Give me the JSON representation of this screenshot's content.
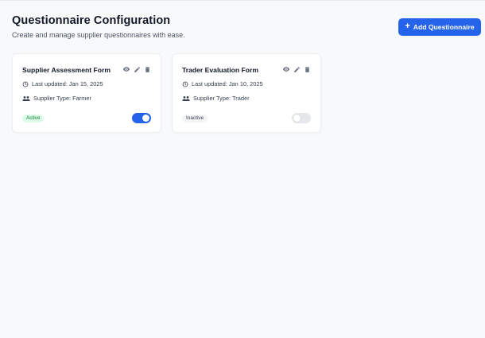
{
  "header": {
    "title": "Questionnaire Configuration",
    "subtitle": "Create and manage supplier questionnaires with ease.",
    "add_button_label": "Add Questionnaire",
    "add_button_icon": "plus-icon"
  },
  "colors": {
    "accent": "#2563eb",
    "active_badge_bg": "#dcfce7",
    "active_badge_text": "#15803d",
    "inactive_badge_bg": "#f3f4f6"
  },
  "cards": [
    {
      "title": "Supplier Assessment Form",
      "last_updated": "Last updated: Jan 15, 2025",
      "supplier_type": "Supplier Type: Farmer",
      "status": "Active",
      "enabled": true,
      "icons": [
        "eye-icon",
        "pencil-icon",
        "trash-icon",
        "clock-icon",
        "users-icon"
      ]
    },
    {
      "title": "Trader Evaluation Form",
      "last_updated": "Last updated: Jan 10, 2025",
      "supplier_type": "Supplier Type: Trader",
      "status": "Inactive",
      "enabled": false,
      "icons": [
        "eye-icon",
        "pencil-icon",
        "trash-icon",
        "clock-icon",
        "users-icon"
      ]
    }
  ]
}
